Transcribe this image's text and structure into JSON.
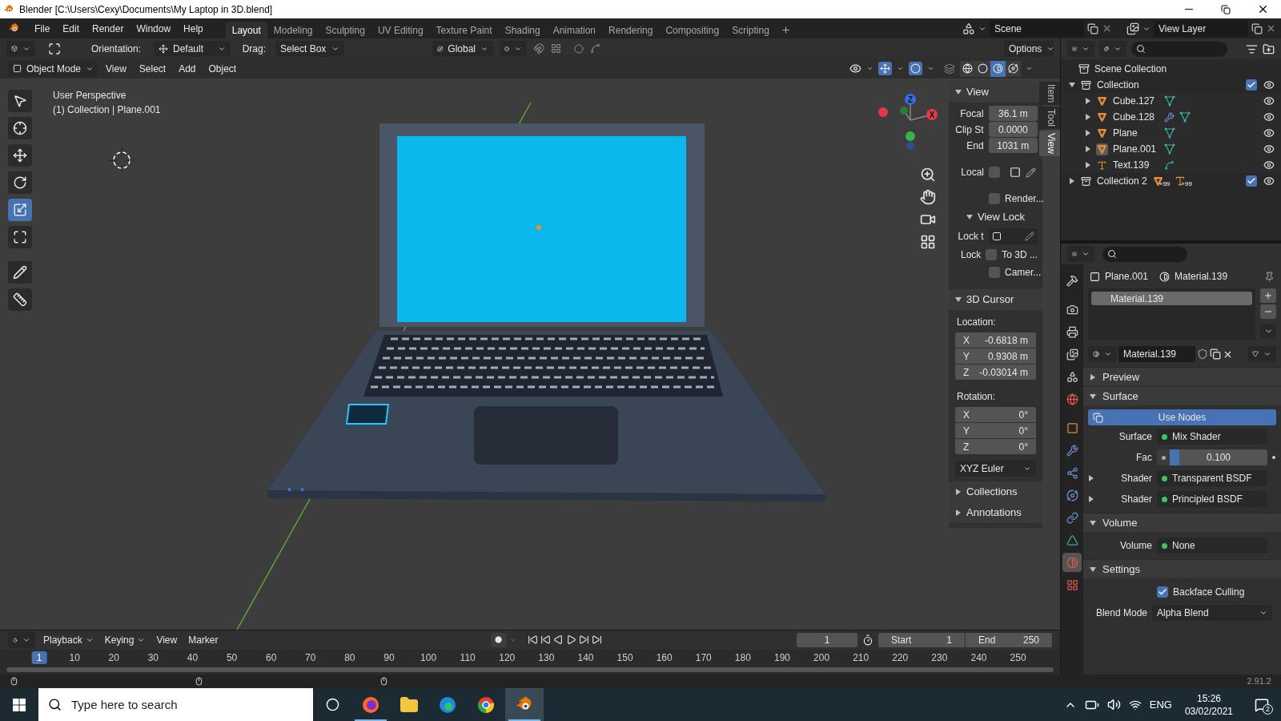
{
  "window": {
    "title": "Blender [C:\\Users\\Cexy\\Documents\\My Laptop in 3D.blend]"
  },
  "menu": [
    "File",
    "Edit",
    "Render",
    "Window",
    "Help"
  ],
  "workspaces": [
    {
      "label": "Layout",
      "selected": true
    },
    {
      "label": "Modeling",
      "selected": false
    },
    {
      "label": "Sculpting",
      "selected": false
    },
    {
      "label": "UV Editing",
      "selected": false
    },
    {
      "label": "Texture Paint",
      "selected": false
    },
    {
      "label": "Shading",
      "selected": false
    },
    {
      "label": "Animation",
      "selected": false
    },
    {
      "label": "Rendering",
      "selected": false
    },
    {
      "label": "Compositing",
      "selected": false
    },
    {
      "label": "Scripting",
      "selected": false
    }
  ],
  "scene": "Scene",
  "view_layer": "View Layer",
  "tool_header": {
    "orientation_label": "Orientation:",
    "orientation": "Default",
    "drag_label": "Drag:",
    "drag": "Select Box",
    "transform_orientation": "Global",
    "options": "Options"
  },
  "viewport_header": {
    "mode": "Object Mode",
    "menus": [
      "View",
      "Select",
      "Add",
      "Object"
    ],
    "shading": [
      {
        "kind": "wireframe",
        "selected": false
      },
      {
        "kind": "solid",
        "selected": false
      },
      {
        "kind": "material",
        "selected": true
      },
      {
        "kind": "rendered",
        "selected": false
      }
    ]
  },
  "tools": [
    {
      "kind": "select",
      "selected": false
    },
    {
      "kind": "cursor",
      "selected": false
    },
    {
      "kind": "move",
      "selected": false
    },
    {
      "kind": "rotate",
      "selected": false
    },
    {
      "kind": "scale",
      "selected": true
    },
    {
      "kind": "transform",
      "selected": false
    },
    {
      "kind": "annotate",
      "selected": false
    },
    {
      "kind": "measure",
      "selected": false
    }
  ],
  "viewport": {
    "view_name": "User Perspective",
    "context": "(1) Collection | Plane.001",
    "gizmo_axes": [
      {
        "label": "Z",
        "color": "#2e6ee0"
      },
      {
        "label": "X",
        "color": "#e23a4b"
      }
    ]
  },
  "sidebar_tabs": [
    {
      "label": "Item",
      "selected": false
    },
    {
      "label": "Tool",
      "selected": false
    },
    {
      "label": "View",
      "selected": true
    }
  ],
  "n_panel": {
    "view": {
      "title": "View",
      "expanded": true,
      "focal_label": "Focal",
      "focal": "36.1 m",
      "clip_start_label": "Clip St",
      "clip_start": "0.0000",
      "clip_end_label": "End",
      "clip_end": "1031 m",
      "local_label": "Local",
      "local_checked": false,
      "render_label": "Render...",
      "render_checked": false
    },
    "view_lock": {
      "title": "View Lock",
      "expanded": true,
      "lock_to_label": "Lock t",
      "lock_label": "Lock",
      "to_3d_label": "To 3D ...",
      "to_3d_checked": false,
      "camera_label": "Camer...",
      "camera_checked": false
    },
    "cursor": {
      "title": "3D Cursor",
      "expanded": true,
      "location_label": "Location:",
      "location": [
        {
          "axis": "X",
          "value": "-0.6818 m"
        },
        {
          "axis": "Y",
          "value": "0.9308 m"
        },
        {
          "axis": "Z",
          "value": "-0.03014 m"
        }
      ],
      "rotation_label": "Rotation:",
      "rotation": [
        {
          "axis": "X",
          "value": "0°"
        },
        {
          "axis": "Y",
          "value": "0°"
        },
        {
          "axis": "Z",
          "value": "0°"
        }
      ],
      "rotation_mode": "XYZ Euler"
    },
    "more": [
      {
        "title": "Collections",
        "expanded": false
      },
      {
        "title": "Annotations",
        "expanded": false
      }
    ]
  },
  "outliner": {
    "root": "Scene Collection",
    "items": [
      {
        "name": "Collection",
        "kind": "collection",
        "expanded": true,
        "checked": true,
        "visible": true,
        "children": [
          {
            "name": "Cube.127",
            "kind": "mesh",
            "expanded": false,
            "active": false,
            "visible": true,
            "extras": [
              {
                "kind": "mesh_data"
              }
            ]
          },
          {
            "name": "Cube.128",
            "kind": "mesh",
            "expanded": false,
            "active": false,
            "visible": true,
            "extras": [
              {
                "kind": "modifier"
              },
              {
                "kind": "mesh_data"
              }
            ]
          },
          {
            "name": "Plane",
            "kind": "mesh",
            "expanded": false,
            "active": false,
            "visible": true,
            "extras": [
              {
                "kind": "mesh_data"
              }
            ]
          },
          {
            "name": "Plane.001",
            "kind": "mesh",
            "expanded": false,
            "active": true,
            "visible": true,
            "extras": [
              {
                "kind": "mesh_data"
              }
            ]
          },
          {
            "name": "Text.139",
            "kind": "text",
            "expanded": false,
            "active": false,
            "visible": true,
            "extras": [
              {
                "kind": "curve_data"
              }
            ]
          }
        ]
      },
      {
        "name": "Collection 2",
        "kind": "collection",
        "expanded": false,
        "checked": true,
        "visible": true,
        "badges": [
          {
            "kind": "mesh",
            "count": "+99"
          },
          {
            "kind": "text",
            "count": "+99"
          }
        ]
      }
    ]
  },
  "properties": {
    "tabs": [
      {
        "kind": "tool",
        "selected": false
      },
      {
        "kind": "render",
        "selected": false
      },
      {
        "kind": "output",
        "selected": false
      },
      {
        "kind": "view_layer",
        "selected": false
      },
      {
        "kind": "scene",
        "selected": false
      },
      {
        "kind": "world",
        "selected": false
      },
      {
        "kind": "object",
        "selected": false
      },
      {
        "kind": "modifiers",
        "selected": false
      },
      {
        "kind": "particles",
        "selected": false
      },
      {
        "kind": "physics",
        "selected": false
      },
      {
        "kind": "constraints",
        "selected": false
      },
      {
        "kind": "data",
        "selected": false
      },
      {
        "kind": "material",
        "selected": true
      },
      {
        "kind": "texture",
        "selected": false
      }
    ],
    "object": "Plane.001",
    "material": "Material.139",
    "slots": [
      {
        "name": "Material.139",
        "selected": true
      }
    ],
    "datablock": "Material.139",
    "panels": [
      {
        "title": "Preview",
        "expanded": false
      },
      {
        "title": "Surface",
        "expanded": true,
        "rows": [
          {
            "kind": "button",
            "label": "Use Nodes"
          },
          {
            "kind": "socket",
            "label": "Surface",
            "value": "Mix Shader",
            "expandable": false
          },
          {
            "kind": "slider",
            "label": "Fac",
            "value": "0.100",
            "level": 0.1
          },
          {
            "kind": "socket",
            "label": "Shader",
            "value": "Transparent BSDF",
            "expandable": true
          },
          {
            "kind": "socket",
            "label": "Shader",
            "value": "Principled BSDF",
            "expandable": true
          }
        ]
      },
      {
        "title": "Volume",
        "expanded": true,
        "rows": [
          {
            "kind": "socket",
            "label": "Volume",
            "value": "None",
            "expandable": false
          }
        ]
      },
      {
        "title": "Settings",
        "expanded": true,
        "rows": [
          {
            "kind": "checkbox",
            "label": "Backface Culling",
            "checked": true
          },
          {
            "kind": "dropdown",
            "label": "Blend Mode",
            "value": "Alpha Blend"
          }
        ]
      }
    ]
  },
  "timeline": {
    "menus": [
      "Playback",
      "Keying",
      "View",
      "Marker"
    ],
    "current_frame": "1",
    "start_label": "Start",
    "start": "1",
    "end_label": "End",
    "end": "250",
    "ruler": [
      {
        "label": "1",
        "selected": true
      },
      {
        "label": "10",
        "selected": false
      },
      {
        "label": "20",
        "selected": false
      },
      {
        "label": "30",
        "selected": false
      },
      {
        "label": "40",
        "selected": false
      },
      {
        "label": "50",
        "selected": false
      },
      {
        "label": "60",
        "selected": false
      },
      {
        "label": "70",
        "selected": false
      },
      {
        "label": "80",
        "selected": false
      },
      {
        "label": "90",
        "selected": false
      },
      {
        "label": "100",
        "selected": false
      },
      {
        "label": "110",
        "selected": false
      },
      {
        "label": "120",
        "selected": false
      },
      {
        "label": "130",
        "selected": false
      },
      {
        "label": "140",
        "selected": false
      },
      {
        "label": "150",
        "selected": false
      },
      {
        "label": "160",
        "selected": false
      },
      {
        "label": "170",
        "selected": false
      },
      {
        "label": "180",
        "selected": false
      },
      {
        "label": "190",
        "selected": false
      },
      {
        "label": "200",
        "selected": false
      },
      {
        "label": "210",
        "selected": false
      },
      {
        "label": "220",
        "selected": false
      },
      {
        "label": "230",
        "selected": false
      },
      {
        "label": "240",
        "selected": false
      },
      {
        "label": "250",
        "selected": false
      }
    ]
  },
  "status_bar": {
    "version": "2.91.2"
  },
  "taskbar": {
    "search": {
      "placeholder": "Type here to search"
    },
    "apps": [
      {
        "kind": "firefox",
        "active": false,
        "running": true
      },
      {
        "kind": "explorer",
        "active": false,
        "running": false
      },
      {
        "kind": "edge",
        "active": false,
        "running": false
      },
      {
        "kind": "chrome",
        "active": false,
        "running": false
      },
      {
        "kind": "blender",
        "active": true,
        "running": true
      }
    ],
    "language": "ENG",
    "time": "15:26",
    "date": "03/02/2021",
    "notifications": "2"
  }
}
